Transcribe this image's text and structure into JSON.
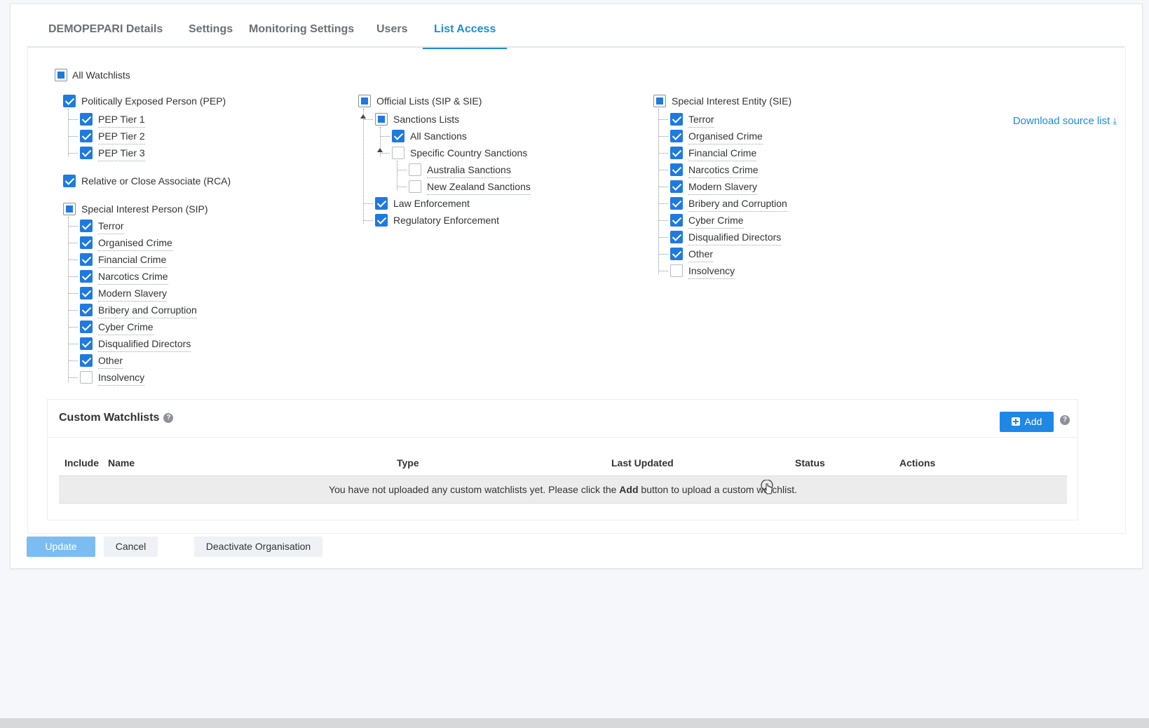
{
  "tabs": [
    {
      "label": "DEMOPEPARI Details",
      "active": false
    },
    {
      "label": "Settings",
      "active": false
    },
    {
      "label": "Monitoring Settings",
      "active": false
    },
    {
      "label": "Users",
      "active": false
    },
    {
      "label": "List Access",
      "active": true
    }
  ],
  "colors": {
    "accent": "#1a8cdb",
    "checkbox": "#1f7ae0"
  },
  "all_watchlists": {
    "label": "All Watchlists",
    "state": "partial"
  },
  "download_link": {
    "label": "Download source list",
    "icon": "download-icon"
  },
  "pep": {
    "label": "Politically Exposed Person (PEP)",
    "state": "checked",
    "items": [
      {
        "label": "PEP Tier 1",
        "state": "checked"
      },
      {
        "label": "PEP Tier 2",
        "state": "checked"
      },
      {
        "label": "PEP Tier 3",
        "state": "checked"
      }
    ]
  },
  "rca": {
    "label": "Relative or Close Associate (RCA)",
    "state": "checked"
  },
  "sip": {
    "label": "Special Interest Person (SIP)",
    "state": "partial",
    "items": [
      {
        "label": "Terror",
        "state": "checked"
      },
      {
        "label": "Organised Crime",
        "state": "checked"
      },
      {
        "label": "Financial Crime",
        "state": "checked"
      },
      {
        "label": "Narcotics Crime",
        "state": "checked"
      },
      {
        "label": "Modern Slavery",
        "state": "checked"
      },
      {
        "label": "Bribery and Corruption",
        "state": "checked"
      },
      {
        "label": "Cyber Crime",
        "state": "checked"
      },
      {
        "label": "Disqualified Directors",
        "state": "checked"
      },
      {
        "label": "Other",
        "state": "checked"
      },
      {
        "label": "Insolvency",
        "state": "unchecked"
      }
    ]
  },
  "official": {
    "label": "Official Lists (SIP & SIE)",
    "state": "partial",
    "sanctions": {
      "label": "Sanctions Lists",
      "state": "partial",
      "all": {
        "label": "All Sanctions",
        "state": "checked"
      },
      "specific": {
        "label": "Specific Country Sanctions",
        "state": "unchecked",
        "items": [
          {
            "label": "Australia Sanctions",
            "state": "unchecked"
          },
          {
            "label": "New Zealand Sanctions",
            "state": "unchecked"
          }
        ]
      }
    },
    "law": {
      "label": "Law Enforcement",
      "state": "checked"
    },
    "regulatory": {
      "label": "Regulatory Enforcement",
      "state": "checked"
    }
  },
  "sie": {
    "label": "Special Interest Entity (SIE)",
    "state": "partial",
    "items": [
      {
        "label": "Terror",
        "state": "checked"
      },
      {
        "label": "Organised Crime",
        "state": "checked"
      },
      {
        "label": "Financial Crime",
        "state": "checked"
      },
      {
        "label": "Narcotics Crime",
        "state": "checked"
      },
      {
        "label": "Modern Slavery",
        "state": "checked"
      },
      {
        "label": "Bribery and Corruption",
        "state": "checked"
      },
      {
        "label": "Cyber Crime",
        "state": "checked"
      },
      {
        "label": "Disqualified Directors",
        "state": "checked"
      },
      {
        "label": "Other",
        "state": "checked"
      },
      {
        "label": "Insolvency",
        "state": "unchecked"
      }
    ]
  },
  "custom": {
    "title": "Custom Watchlists",
    "add_label": "Add",
    "columns": [
      "Include",
      "Name",
      "Type",
      "Last Updated",
      "Status",
      "Actions"
    ],
    "empty_before": "You have not uploaded any custom watchlists yet. Please click the ",
    "empty_bold": "Add",
    "empty_after": " button to upload a custom watchlist."
  },
  "buttons": {
    "update": "Update",
    "cancel": "Cancel",
    "deactivate": "Deactivate Organisation"
  }
}
